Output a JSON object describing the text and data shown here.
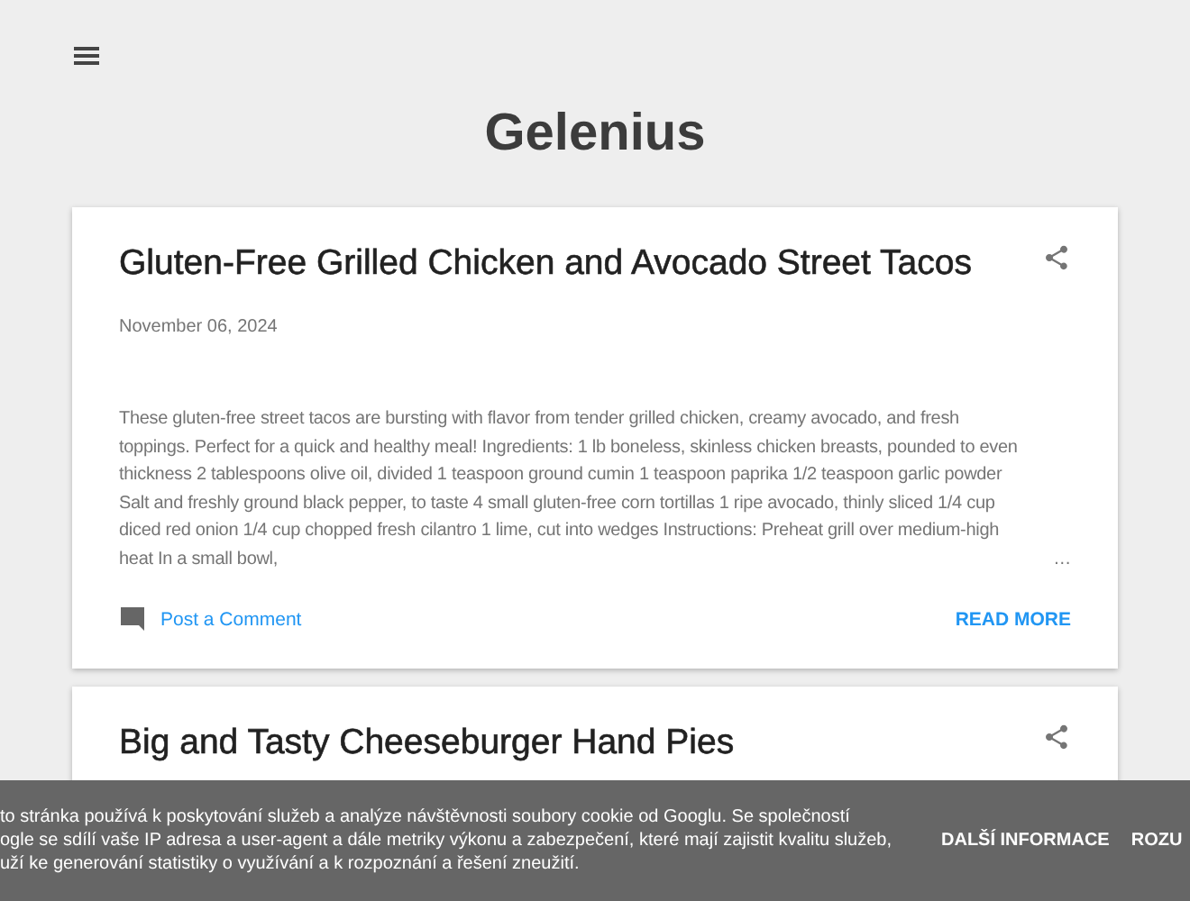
{
  "blog_title": "Gelenius",
  "posts": [
    {
      "title": "Gluten-Free Grilled Chicken and Avocado Street Tacos",
      "date": "November 06, 2024",
      "snippet": "These gluten-free street tacos are bursting with flavor from tender grilled chicken, creamy avocado, and fresh toppings. Perfect for a quick and healthy meal! Ingredients: 1 lb boneless, skinless chicken breasts, pounded to even thickness 2 tablespoons olive oil, divided 1 teaspoon ground cumin 1 teaspoon paprika 1/2 teaspoon garlic powder Salt and freshly ground black pepper, to taste 4 small gluten-free corn tortillas 1 ripe avocado, thinly sliced 1/4 cup diced red onion 1/4 cup chopped fresh cilantro 1 lime, cut into wedges Instructions: Preheat grill over medium-high heat In a small bowl,",
      "ellipsis": "…",
      "comment_link": "Post a Comment",
      "read_more": "READ MORE"
    },
    {
      "title": "Big and Tasty Cheeseburger Hand Pies"
    }
  ],
  "cookie_bar": {
    "lines": [
      "to stránka používá k poskytování služeb a analýze návštěvnosti soubory cookie od Googlu. Se společností",
      "ogle se sdílí vaše IP adresa a user-agent a dále metriky výkonu a zabezpečení, které mají zajistit kvalitu služeb,",
      "uží ke generování statistiky o využívání a k rozpoznání a řešení zneužití."
    ],
    "buttons": [
      "DALŠÍ INFORMACE",
      "ROZU"
    ]
  }
}
